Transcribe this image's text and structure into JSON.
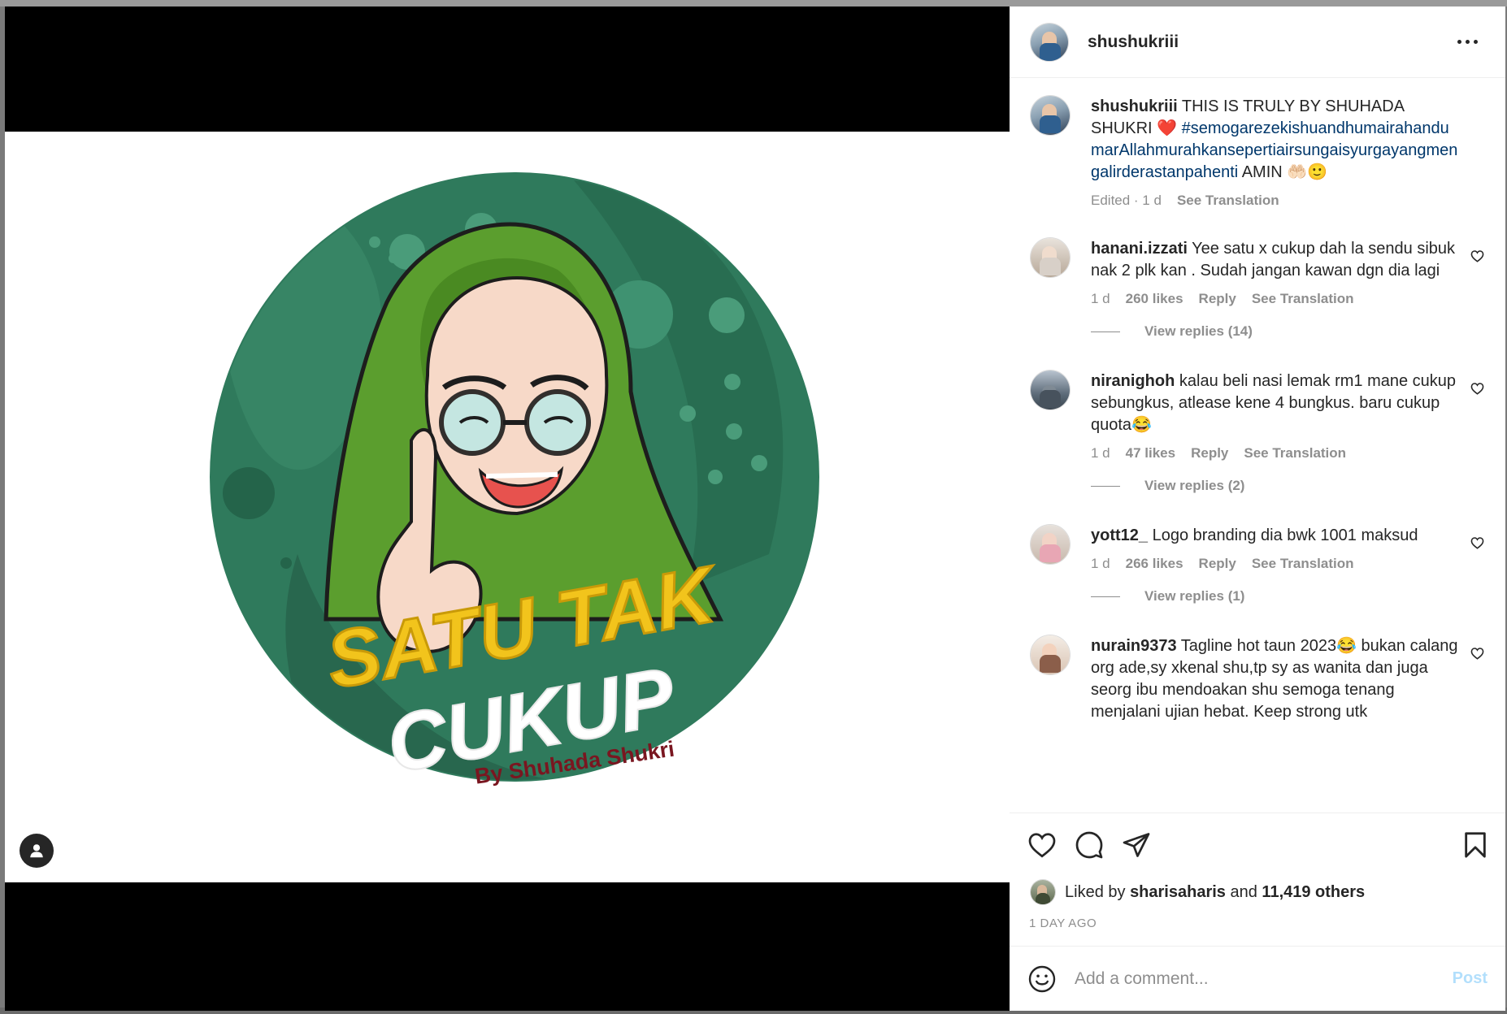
{
  "post": {
    "username": "shushukriii",
    "caption_user": "shushukriii",
    "caption_text": " THIS IS TRULY BY SHUHADA SHUKRI ❤️ ",
    "caption_hashtag": "#semogarezekishuandhumairahandumarAllahmurahkansepertiairsungaisyurgayangmengalirderastanpahenti",
    "caption_tail": " AMIN 🤲🏻🙂",
    "caption_edited": "Edited · 1 d",
    "see_translation": "See Translation",
    "logo_line1": "SATU TAK",
    "logo_line2": "CUKUP",
    "logo_byline": "By Shuhada Shukri"
  },
  "comments": [
    {
      "username": "hanani.izzati",
      "text": " Yee satu x cukup dah la sendu sibuk nak 2 plk kan . Sudah jangan kawan dgn dia lagi",
      "time": "1 d",
      "likes": "260 likes",
      "reply": "Reply",
      "translate": "See Translation",
      "view_replies": "View replies (14)"
    },
    {
      "username": "niranighoh",
      "text": " kalau beli nasi lemak rm1 mane cukup sebungkus, atlease kene 4 bungkus. baru cukup quota😂",
      "time": "1 d",
      "likes": "47 likes",
      "reply": "Reply",
      "translate": "See Translation",
      "view_replies": "View replies (2)"
    },
    {
      "username": "yott12_",
      "text": " Logo branding dia bwk 1001 maksud",
      "time": "1 d",
      "likes": "266 likes",
      "reply": "Reply",
      "translate": "See Translation",
      "view_replies": "View replies (1)"
    },
    {
      "username": "nurain9373",
      "text": " Tagline hot taun 2023😂 bukan calang org ade,sy xkenal shu,tp sy as wanita dan juga seorg ibu mendoakan shu semoga tenang menjalani ujian hebat. Keep strong utk"
    }
  ],
  "likes": {
    "prefix": "Liked by",
    "user": "sharisaharis",
    "and": "and",
    "others": "11,419 others"
  },
  "timestamp": "1 DAY AGO",
  "add_comment": {
    "placeholder": "Add a comment...",
    "post_label": "Post"
  },
  "icons": {
    "more": "more-horizontal-icon",
    "like": "heart-icon",
    "comment": "comment-bubble-icon",
    "share": "paper-plane-icon",
    "save": "bookmark-icon",
    "emoji": "emoji-smile-icon",
    "tag": "user-tag-icon"
  },
  "colors": {
    "hashtag": "#00376b",
    "post_disabled": "#b2dffc",
    "muted": "#8e8e8e",
    "logo_green": "#2f7a5c",
    "hijab_green": "#5b9e2e",
    "logo_yellow": "#f2c41c"
  }
}
